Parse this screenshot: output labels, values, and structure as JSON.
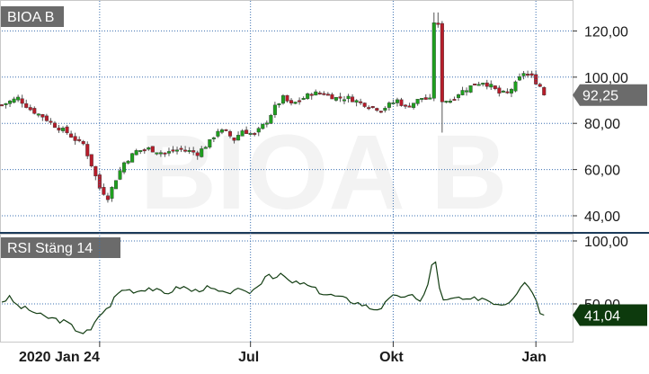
{
  "chart_data": [
    {
      "type": "candlestick",
      "title": "BIOA B",
      "watermark": "BIOA B",
      "ylim": [
        33,
        133
      ],
      "yticks": [
        40,
        60,
        80,
        100,
        120
      ],
      "ytick_labels": [
        "40,00",
        "60,00",
        "80,00",
        "100,00",
        "120,00"
      ],
      "last_price": 92.25,
      "last_price_label": "92,25",
      "grid": true,
      "colors": {
        "up": "#1ea01e",
        "down": "#b81c2a",
        "wick": "#555555",
        "badge_bg": "#6b6b6b",
        "badge_text": "#ffffff"
      },
      "waypoints": [
        [
          0,
          88
        ],
        [
          4,
          91
        ],
        [
          7,
          86
        ],
        [
          10,
          83
        ],
        [
          13,
          79
        ],
        [
          16,
          76
        ],
        [
          18,
          73
        ],
        [
          20,
          71
        ],
        [
          22,
          62
        ],
        [
          24,
          52
        ],
        [
          26,
          48
        ],
        [
          28,
          56
        ],
        [
          30,
          63
        ],
        [
          33,
          68
        ],
        [
          36,
          69
        ],
        [
          40,
          67
        ],
        [
          44,
          69
        ],
        [
          48,
          67
        ],
        [
          51,
          72
        ],
        [
          53,
          77
        ],
        [
          55,
          76
        ],
        [
          57,
          73
        ],
        [
          59,
          77
        ],
        [
          62,
          75
        ],
        [
          65,
          81
        ],
        [
          67,
          87
        ],
        [
          69,
          91
        ],
        [
          71,
          88
        ],
        [
          73,
          90
        ],
        [
          76,
          93
        ],
        [
          79,
          93
        ],
        [
          82,
          91
        ],
        [
          85,
          91
        ],
        [
          88,
          89
        ],
        [
          91,
          87
        ],
        [
          93,
          86
        ],
        [
          95,
          88
        ],
        [
          97,
          90
        ],
        [
          99,
          87
        ],
        [
          101,
          89
        ],
        [
          103,
          91
        ],
        [
          105,
          90
        ],
        [
          106,
          124
        ],
        [
          107,
          122
        ],
        [
          108,
          90
        ],
        [
          110,
          90
        ],
        [
          112,
          93
        ],
        [
          114,
          95
        ],
        [
          116,
          97
        ],
        [
          118,
          98
        ],
        [
          120,
          96
        ],
        [
          122,
          93
        ],
        [
          124,
          93
        ],
        [
          126,
          97
        ],
        [
          128,
          102
        ],
        [
          130,
          100
        ],
        [
          132,
          96
        ],
        [
          133,
          92.25
        ]
      ],
      "n_candles": 134
    },
    {
      "type": "line",
      "title": "RSI Stäng 14",
      "ylim": [
        20,
        105
      ],
      "yticks": [
        50,
        100
      ],
      "ytick_labels": [
        "50,00",
        "100,00"
      ],
      "last_value": 41.04,
      "last_value_label": "41,04",
      "grid": true,
      "colors": {
        "line": "#123d12",
        "badge_bg": "#0d3a0d",
        "badge_text": "#ffffff"
      },
      "waypoints": [
        [
          0,
          52
        ],
        [
          2,
          55
        ],
        [
          4,
          48
        ],
        [
          7,
          45
        ],
        [
          10,
          40
        ],
        [
          13,
          38
        ],
        [
          16,
          35
        ],
        [
          18,
          30
        ],
        [
          20,
          27
        ],
        [
          22,
          29
        ],
        [
          24,
          42
        ],
        [
          26,
          46
        ],
        [
          28,
          57
        ],
        [
          30,
          62
        ],
        [
          33,
          60
        ],
        [
          36,
          63
        ],
        [
          40,
          58
        ],
        [
          44,
          64
        ],
        [
          47,
          60
        ],
        [
          50,
          63
        ],
        [
          53,
          60
        ],
        [
          55,
          57
        ],
        [
          57,
          62
        ],
        [
          60,
          58
        ],
        [
          63,
          64
        ],
        [
          65,
          75
        ],
        [
          67,
          71
        ],
        [
          69,
          73
        ],
        [
          71,
          66
        ],
        [
          73,
          67
        ],
        [
          76,
          63
        ],
        [
          79,
          58
        ],
        [
          82,
          56
        ],
        [
          85,
          53
        ],
        [
          88,
          50
        ],
        [
          91,
          46
        ],
        [
          93,
          47
        ],
        [
          95,
          53
        ],
        [
          97,
          58
        ],
        [
          99,
          54
        ],
        [
          101,
          57
        ],
        [
          103,
          52
        ],
        [
          105,
          70
        ],
        [
          106,
          92
        ],
        [
          107,
          70
        ],
        [
          108,
          52
        ],
        [
          110,
          53
        ],
        [
          112,
          55
        ],
        [
          114,
          52
        ],
        [
          116,
          54
        ],
        [
          118,
          55
        ],
        [
          120,
          52
        ],
        [
          122,
          50
        ],
        [
          124,
          51
        ],
        [
          126,
          58
        ],
        [
          128,
          68
        ],
        [
          130,
          62
        ],
        [
          132,
          44
        ],
        [
          133,
          41.04
        ]
      ]
    }
  ],
  "x_axis": {
    "labels": [
      {
        "text": "2020 Jan 24",
        "t": 24
      },
      {
        "text": "Jul",
        "t": 61
      },
      {
        "text": "Okt",
        "t": 96
      },
      {
        "text": "Jan",
        "t": 131
      }
    ],
    "t_max": 140
  }
}
